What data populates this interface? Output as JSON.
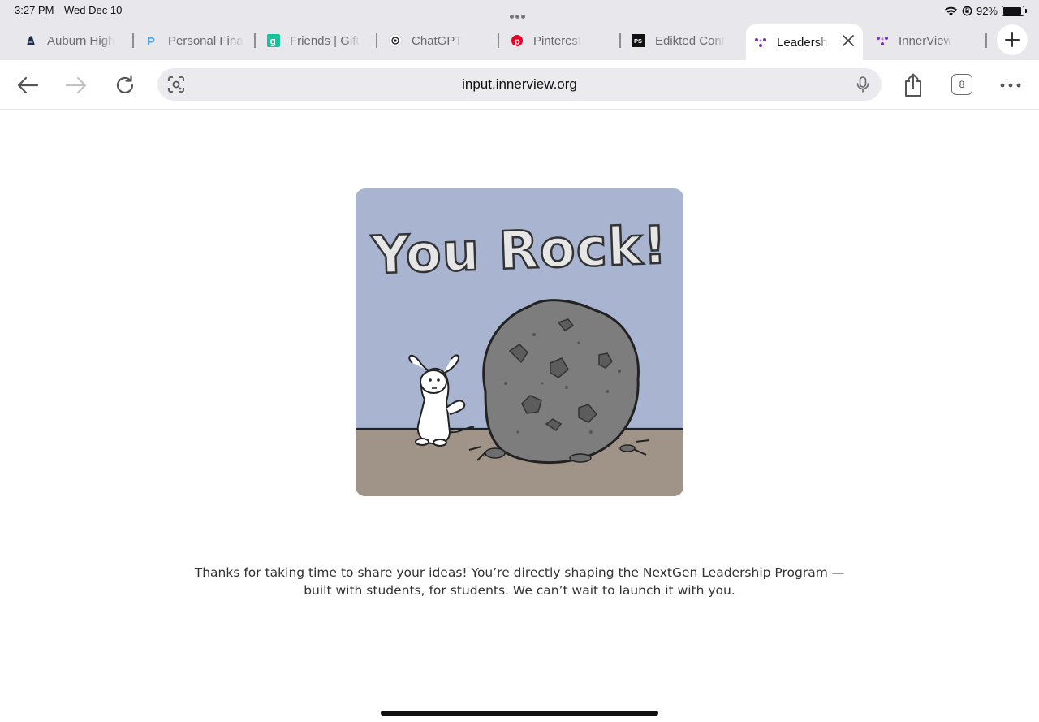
{
  "status_bar": {
    "time": "3:27 PM",
    "date": "Wed Dec 10",
    "battery": "92%",
    "battery_level": 0.92
  },
  "tabs": [
    {
      "label": "Auburn High",
      "icon": "auburn-icon"
    },
    {
      "label": "Personal Fina",
      "icon": "paypal-icon"
    },
    {
      "label": "Friends | Gift",
      "icon": "grammarly-icon"
    },
    {
      "label": "ChatGPT",
      "icon": "chatgpt-icon"
    },
    {
      "label": "Pinterest",
      "icon": "pinterest-icon"
    },
    {
      "label": "Edikted Cont",
      "icon": "ps-icon"
    },
    {
      "label": "Leadersh",
      "icon": "innerview-icon",
      "active": true
    },
    {
      "label": "InnerView",
      "icon": "innerview-icon"
    }
  ],
  "toolbar": {
    "url": "input.innerview.org",
    "tab_count": "8"
  },
  "hero_image": {
    "caption_art": "You Rock!",
    "colors": {
      "sky": "#a8b4d0",
      "ground": "#a09488",
      "rock": "#7d7d7d"
    }
  },
  "message": {
    "line1": "Thanks for taking  time to share your ideas! You’re directly shaping the NextGen Leadership Program —",
    "line2": "built with students, for students. We can’t wait to launch it with you."
  },
  "colors": {
    "chrome_bg": "#e8e8ec",
    "accent_purple": "#7b2fbe",
    "pinterest_red": "#e60023",
    "grammarly_green": "#15c39a"
  }
}
